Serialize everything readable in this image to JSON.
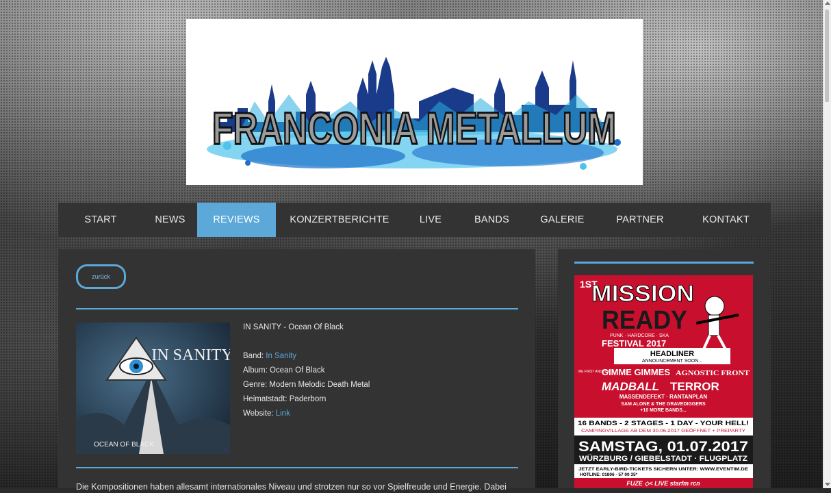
{
  "logo": {
    "text": "FRANCONIA METALLUM"
  },
  "nav": {
    "items": [
      {
        "label": "START"
      },
      {
        "label": "NEWS"
      },
      {
        "label": "REVIEWS",
        "active": true
      },
      {
        "label": "KONZERTBERICHTE"
      },
      {
        "label": "LIVE"
      },
      {
        "label": "BANDS"
      },
      {
        "label": "GALERIE"
      },
      {
        "label": "PARTNER"
      },
      {
        "label": "KONTAKT"
      }
    ]
  },
  "review": {
    "back_label": "zurück",
    "title": "IN SANITY - Ocean Of Black",
    "band_label": "Band: ",
    "band_value": "In Sanity",
    "album": "Album: Ocean Of Black",
    "genre": "Genre: Modern Melodic Death Metal",
    "hometown": "Heimatstadt: Paderborn",
    "website_label": "Website: ",
    "website_value": "Link",
    "cover": {
      "band_text": "IN SANITY",
      "album_text": "OCEAN OF BLACK"
    },
    "body_start": "Die Kompositionen haben allesamt internationales Niveau und strotzen nur so vor Spielfreude und Energie. Dabei"
  },
  "sidebar_ad": {
    "badge": "1ST",
    "line1": "MISSION",
    "line2": "READY",
    "tagline": "PUNK · HARDCORE · SKA",
    "festival": "FESTIVAL 2017",
    "headliner": "HEADLINER",
    "announcement": "ANNOUNCEMENT SOON...",
    "band1": "GIMME GIMMES",
    "band1_prefix": "ME FIRST AND THE",
    "band2": "AGNOSTIC FRONT",
    "band3": "MADBALL",
    "band4": "TERROR",
    "band5": "MASSENDEFEKT · RANTANPLAN",
    "band6": "SAM ALONE & THE GRAVEDIGGERS",
    "band7": "+10 MORE BANDS...",
    "stats": "16 BANDS - 2 STAGES - 1 DAY - YOUR HELL!",
    "camping": "CAMPINGVILLAGE AB DEM 30.06.2017 GEÖFFNET + PREPARTY",
    "date": "SAMSTAG, 01.07.2017",
    "location": "WÜRZBURG / GIEBELSTADT · FLUGPLATZ",
    "tickets": "JETZT EARLY-BIRD-TICKETS SICHERN UNTER: WWW.EVENTIM.DE",
    "hotline": "HOTLINE: 01806 - 57 00 35*",
    "sponsors": "FUZE  ◇< LIVE  starfm  rcn"
  }
}
